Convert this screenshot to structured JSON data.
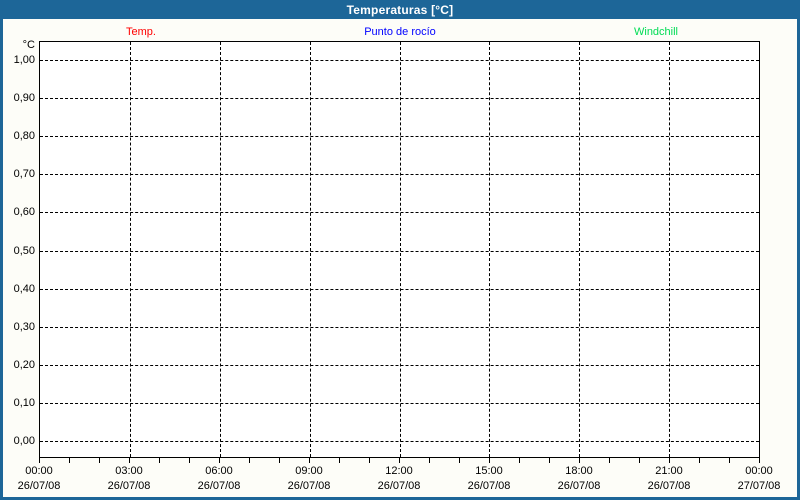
{
  "window": {
    "title": "Temperaturas [°C]"
  },
  "colors": {
    "frame": "#1D6698",
    "title_text": "#FFFFFF",
    "plot_background": "#FFFFFF",
    "grid": "#000000",
    "temp": "#FF0000",
    "dew_point": "#0000FF",
    "windchill": "#00DC55"
  },
  "chart_data": {
    "type": "line",
    "title": "Temperaturas [°C]",
    "xlabel": "",
    "ylabel": "°C",
    "ylim": [
      0.0,
      1.0
    ],
    "y_tick_step": 0.1,
    "grid": "dashed, on",
    "legend_position": "top, horizontal",
    "y_ticks": [
      "1,00",
      "0,90",
      "0,80",
      "0,70",
      "0,60",
      "0,50",
      "0,40",
      "0,30",
      "0,20",
      "0,10",
      "0,00"
    ],
    "x_ticks": [
      {
        "time": "00:00",
        "date": "26/07/08"
      },
      {
        "time": "03:00",
        "date": "26/07/08"
      },
      {
        "time": "06:00",
        "date": "26/07/08"
      },
      {
        "time": "09:00",
        "date": "26/07/08"
      },
      {
        "time": "12:00",
        "date": "26/07/08"
      },
      {
        "time": "15:00",
        "date": "26/07/08"
      },
      {
        "time": "18:00",
        "date": "26/07/08"
      },
      {
        "time": "21:00",
        "date": "26/07/08"
      },
      {
        "time": "00:00",
        "date": "27/07/08"
      }
    ],
    "x_minor_ticks": "every hour",
    "series": [
      {
        "name": "Temp.",
        "color": "#FF0000",
        "values": []
      },
      {
        "name": "Punto de rocío",
        "color": "#0000FF",
        "values": []
      },
      {
        "name": "Windchill",
        "color": "#00DC55",
        "values": []
      }
    ],
    "note": "plot area is empty - no data drawn"
  }
}
